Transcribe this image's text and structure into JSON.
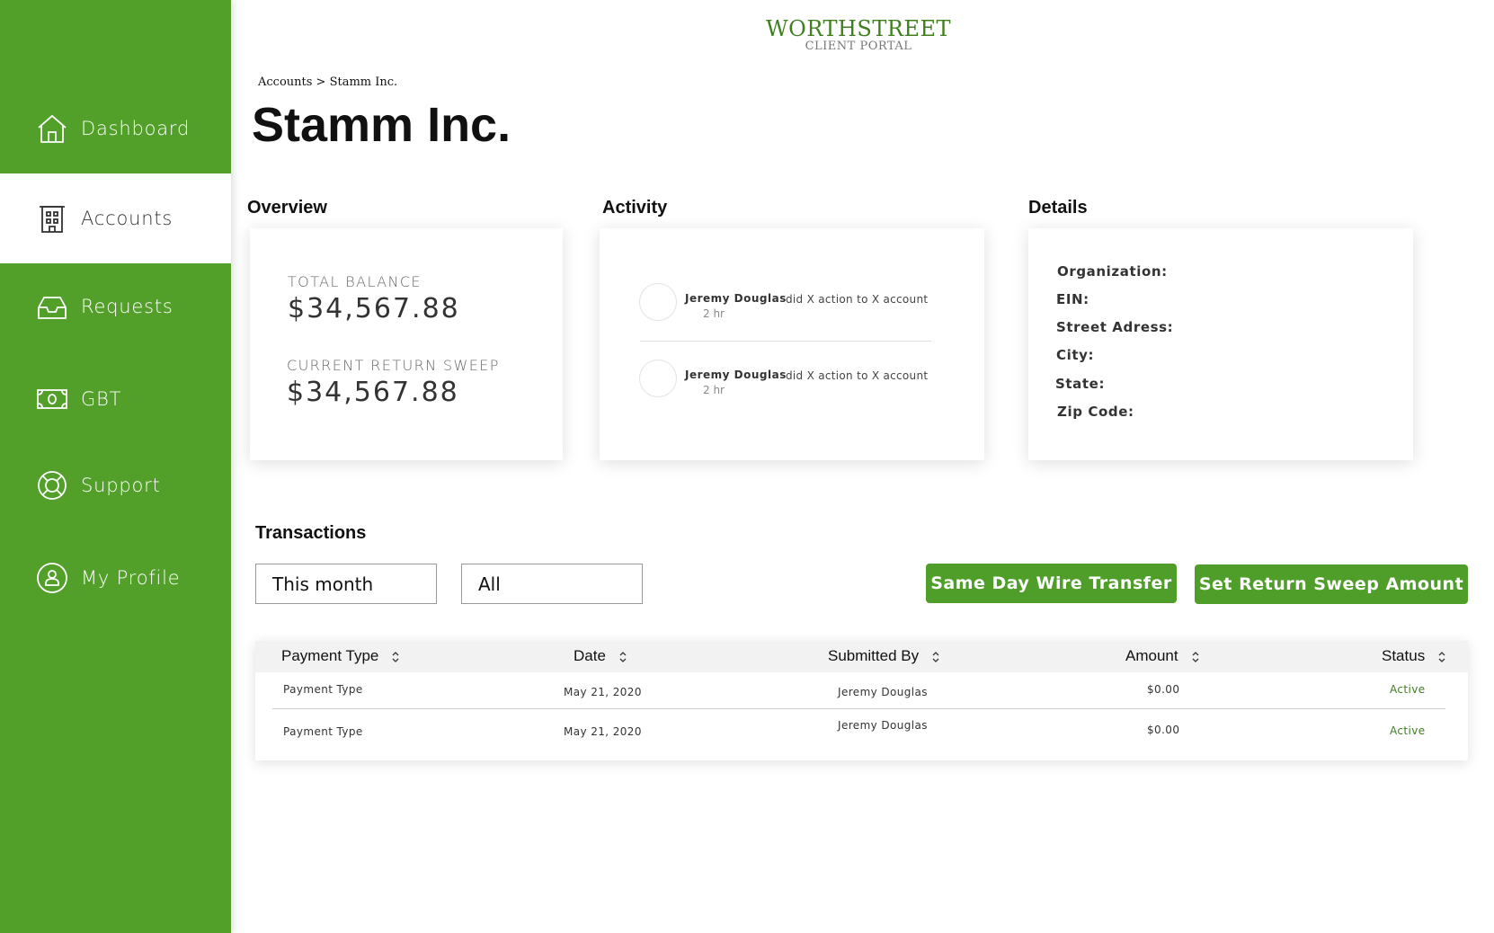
{
  "brand": {
    "name": "WORTHSTREET",
    "subtitle": "CLIENT PORTAL"
  },
  "sidebar": {
    "items": [
      {
        "label": "Dashboard",
        "icon": "home-icon",
        "active": false
      },
      {
        "label": "Accounts",
        "icon": "building-icon",
        "active": true
      },
      {
        "label": "Requests",
        "icon": "inbox-icon",
        "active": false
      },
      {
        "label": "GBT",
        "icon": "cash-icon",
        "active": false
      },
      {
        "label": "Support",
        "icon": "lifebuoy-icon",
        "active": false
      },
      {
        "label": "My Profile",
        "icon": "user-icon",
        "active": false
      }
    ]
  },
  "breadcrumb": "Accounts > Stamm Inc.",
  "page_title": "Stamm Inc.",
  "overview": {
    "title": "Overview",
    "total_balance_label": "TOTAL BALANCE",
    "total_balance_value": "$34,567.88",
    "return_sweep_label": "CURRENT RETURN SWEEP",
    "return_sweep_value": "$34,567.88"
  },
  "activity": {
    "title": "Activity",
    "items": [
      {
        "name": "Jeremy Douglas",
        "text": "did X action to X account",
        "time": "2 hr"
      },
      {
        "name": "Jeremy Douglas",
        "text": "did X action to X account",
        "time": "2 hr"
      }
    ]
  },
  "details": {
    "title": "Details",
    "labels": [
      "Organization:",
      "EIN:",
      "Street Adress:",
      "City:",
      "State:",
      "Zip Code:"
    ]
  },
  "transactions": {
    "title": "Transactions",
    "filter_period": "This month",
    "filter_type": "All",
    "wire_button": "Same Day Wire Transfer",
    "sweep_button": "Set Return Sweep Amount",
    "columns": [
      "Payment Type",
      "Date",
      "Submitted By",
      "Amount",
      "Status"
    ],
    "rows": [
      [
        "Payment Type",
        "May 21, 2020",
        "Jeremy Douglas",
        "$0.00",
        "Active"
      ],
      [
        "Payment Type",
        "May 21, 2020",
        "Jeremy Douglas",
        "$0.00",
        "Active"
      ]
    ]
  },
  "colors": {
    "brand_green": "#52a02a",
    "button_green": "#4f9e2a",
    "status_green": "#3f7f1e"
  }
}
